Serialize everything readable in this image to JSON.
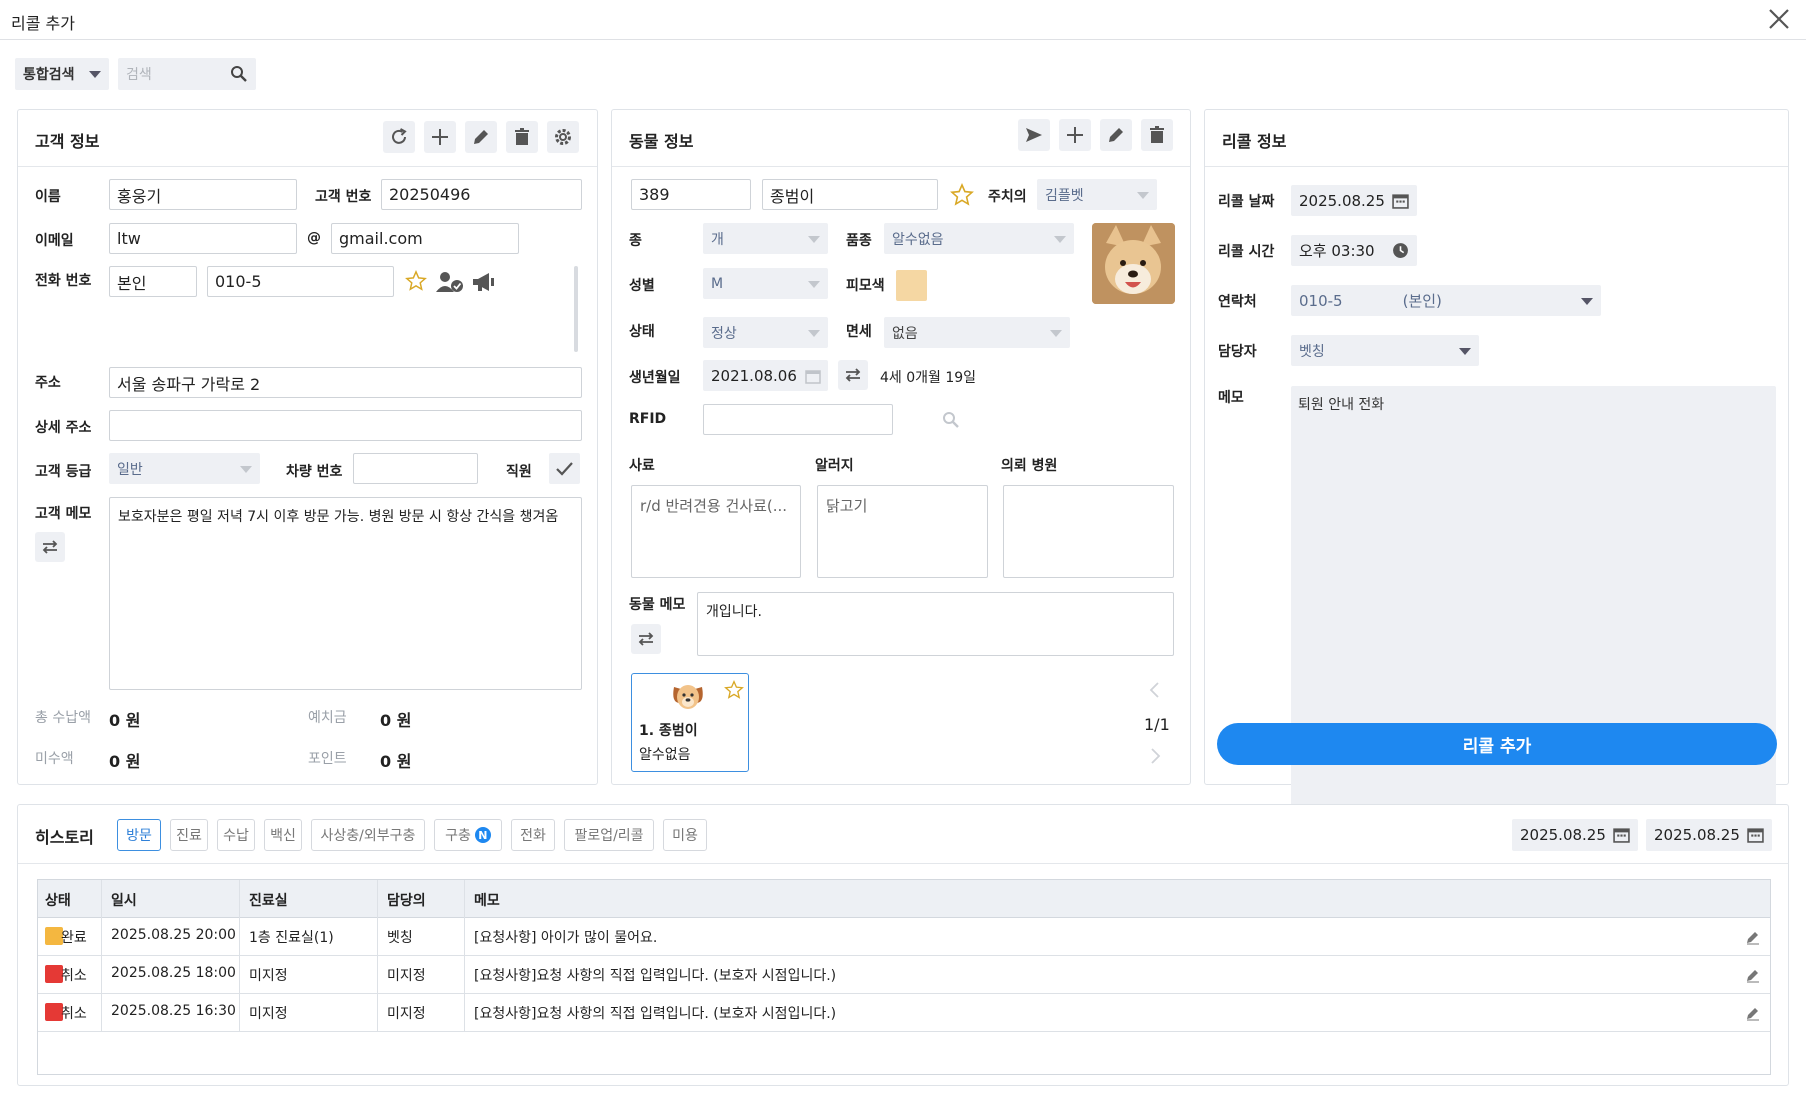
{
  "window": {
    "title": "리콜 추가"
  },
  "search": {
    "mode": "통합검색",
    "placeholder": "검색"
  },
  "customer": {
    "title": "고객 정보",
    "name_label": "이름",
    "name": "홍웅기",
    "id_label": "고객 번호",
    "id": "20250496",
    "email_label": "이메일",
    "email_user": "ltw",
    "email_at": "@",
    "email_domain": "gmail.com",
    "phone_label": "전화 번호",
    "phone_type": "본인",
    "phone": "010-5",
    "address_label": "주소",
    "address": "서울 송파구 가락로 2",
    "detail_address_label": "상세 주소",
    "detail_address": "",
    "grade_label": "고객 등급",
    "grade": "일반",
    "car_label": "차량 번호",
    "car": "",
    "staff_label": "직원",
    "memo_label": "고객 메모",
    "memo": "보호자분은 평일 저녁 7시 이후 방문 가능. 병원 방문 시 항상 간식을 챙겨옴",
    "total_paid_label": "총 수납액",
    "total_paid": "0 원",
    "deposit_label": "예치금",
    "deposit": "0 원",
    "unpaid_label": "미수액",
    "unpaid": "0 원",
    "point_label": "포인트",
    "point": "0 원"
  },
  "animal": {
    "title": "동물 정보",
    "number": "389",
    "name": "종범이",
    "vet_label": "주치의",
    "vet": "김플벳",
    "species_label": "종",
    "species": "개",
    "breed_label": "품종",
    "breed": "알수없음",
    "sex_label": "성별",
    "sex": "M",
    "coat_label": "피모색",
    "coat_color": "#f5d7a3",
    "status_label": "상태",
    "status": "정상",
    "tax_label": "면세",
    "tax": "없음",
    "birth_label": "생년월일",
    "birth": "2021.08.06",
    "age": "4세 0개월 19일",
    "rfid_label": "RFID",
    "rfid": "",
    "food_label": "사료",
    "food": "r/d 반려견용 건사료(...",
    "allergy_label": "알러지",
    "allergy": "닭고기",
    "ref_hospital_label": "의뢰 병원",
    "ref_hospital": "",
    "memo_label": "동물 메모",
    "memo": "개입니다.",
    "card_name": "1. 종범이",
    "card_breed": "알수없음",
    "page": "1/1"
  },
  "recall": {
    "title": "리콜 정보",
    "date_label": "리콜 날짜",
    "date": "2025.08.25",
    "time_label": "리콜 시간",
    "time": "오후 03:30",
    "contact_label": "연락처",
    "contact_phone": "010-5",
    "contact_type": "(본인)",
    "manager_label": "담당자",
    "manager": "벳칭",
    "memo_label": "메모",
    "memo": "퇴원 안내 전화",
    "submit": "리콜 추가"
  },
  "history": {
    "title": "히스토리",
    "tabs": [
      "방문",
      "진료",
      "수납",
      "백신",
      "사상충/외부구충",
      "구충",
      "전화",
      "팔로업/리콜",
      "미용"
    ],
    "badge": "N",
    "date_from": "2025.08.25",
    "date_to": "2025.08.25",
    "columns": [
      "상태",
      "일시",
      "진료실",
      "담당의",
      "메모"
    ],
    "rows": [
      {
        "status": "완료",
        "color": "#f4b740",
        "datetime": "2025.08.25 20:00",
        "room": "1층 진료실(1)",
        "doctor": "벳칭",
        "memo": "[요청사항] 아이가 많이 물어요."
      },
      {
        "status": "취소",
        "color": "#e53935",
        "datetime": "2025.08.25 18:00",
        "room": "미지정",
        "doctor": "미지정",
        "memo": "[요청사항]요청 사항의 직접 입력입니다. (보호자 시점입니다.)"
      },
      {
        "status": "취소",
        "color": "#e53935",
        "datetime": "2025.08.25 16:30",
        "room": "미지정",
        "doctor": "미지정",
        "memo": "[요청사항]요청 사항의 직접 입력입니다. (보호자 시점입니다.)"
      }
    ]
  }
}
